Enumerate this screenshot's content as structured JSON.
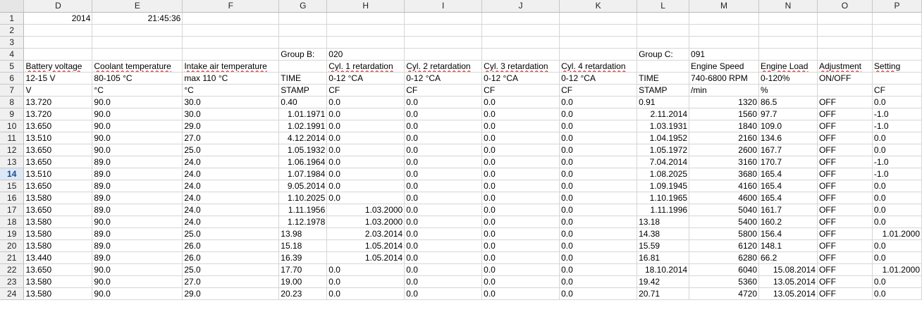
{
  "columns": [
    {
      "id": "D",
      "label": "D"
    },
    {
      "id": "E",
      "label": "E"
    },
    {
      "id": "F",
      "label": "F"
    },
    {
      "id": "G",
      "label": "G"
    },
    {
      "id": "H",
      "label": "H"
    },
    {
      "id": "I",
      "label": "I"
    },
    {
      "id": "J",
      "label": "J"
    },
    {
      "id": "K",
      "label": "K"
    },
    {
      "id": "L",
      "label": "L"
    },
    {
      "id": "M",
      "label": "M"
    },
    {
      "id": "N",
      "label": "N"
    },
    {
      "id": "O",
      "label": "O"
    },
    {
      "id": "P",
      "label": "P"
    }
  ],
  "active_row": "14",
  "rows": [
    {
      "n": "1",
      "cells": [
        [
          "2014",
          "num"
        ],
        [
          "21:45:36",
          "num"
        ],
        [
          "",
          ""
        ],
        [
          "",
          ""
        ],
        [
          "",
          ""
        ],
        [
          "",
          ""
        ],
        [
          "",
          ""
        ],
        [
          "",
          ""
        ],
        [
          "",
          ""
        ],
        [
          "",
          ""
        ],
        [
          "",
          ""
        ],
        [
          "",
          ""
        ],
        [
          "",
          ""
        ]
      ]
    },
    {
      "n": "2",
      "cells": [
        [
          "",
          ""
        ],
        [
          "",
          ""
        ],
        [
          "",
          ""
        ],
        [
          "",
          ""
        ],
        [
          "",
          ""
        ],
        [
          "",
          ""
        ],
        [
          "",
          ""
        ],
        [
          "",
          ""
        ],
        [
          "",
          ""
        ],
        [
          "",
          ""
        ],
        [
          "",
          ""
        ],
        [
          "",
          ""
        ],
        [
          "",
          ""
        ]
      ]
    },
    {
      "n": "3",
      "cells": [
        [
          "",
          ""
        ],
        [
          "",
          ""
        ],
        [
          "",
          ""
        ],
        [
          "",
          ""
        ],
        [
          "",
          ""
        ],
        [
          "",
          ""
        ],
        [
          "",
          ""
        ],
        [
          "",
          ""
        ],
        [
          "",
          ""
        ],
        [
          "",
          ""
        ],
        [
          "",
          ""
        ],
        [
          "",
          ""
        ],
        [
          "",
          ""
        ]
      ]
    },
    {
      "n": "4",
      "cells": [
        [
          "",
          ""
        ],
        [
          "",
          ""
        ],
        [
          "",
          ""
        ],
        [
          "Group B:",
          "txt"
        ],
        [
          "020",
          "txt"
        ],
        [
          "",
          ""
        ],
        [
          "",
          ""
        ],
        [
          "",
          ""
        ],
        [
          "Group C:",
          "txt"
        ],
        [
          "091",
          "txt"
        ],
        [
          "",
          ""
        ],
        [
          "",
          ""
        ],
        [
          "",
          ""
        ]
      ]
    },
    {
      "n": "5",
      "cells": [
        [
          "Battery voltage",
          "sq"
        ],
        [
          "Coolant temperature",
          "sq"
        ],
        [
          "Intake air temperature",
          "sq"
        ],
        [
          "",
          ""
        ],
        [
          "Cyl. 1 retardation",
          "sq"
        ],
        [
          "Cyl. 2 retardation",
          "sq"
        ],
        [
          "Cyl. 3 retardation",
          "sq"
        ],
        [
          "Cyl. 4 retardation",
          "sq"
        ],
        [
          "",
          ""
        ],
        [
          "Engine Speed",
          "txt"
        ],
        [
          "Engine Load",
          "sq"
        ],
        [
          "Adjustment",
          "sq"
        ],
        [
          "Setting",
          "sq"
        ]
      ]
    },
    {
      "n": "6",
      "cells": [
        [
          "12-15 V",
          "txt"
        ],
        [
          "80-105 °C",
          "txt"
        ],
        [
          "max 110 °C",
          "txt"
        ],
        [
          "TIME",
          "txt"
        ],
        [
          "0-12 °CA",
          "txt"
        ],
        [
          "0-12 °CA",
          "txt"
        ],
        [
          "0-12 °CA",
          "txt"
        ],
        [
          "0-12 °CA",
          "txt"
        ],
        [
          "TIME",
          "txt"
        ],
        [
          "740-6800 RPM",
          "txt"
        ],
        [
          "0-120%",
          "txt"
        ],
        [
          "ON/OFF",
          "txt"
        ],
        [
          "",
          ""
        ]
      ]
    },
    {
      "n": "7",
      "cells": [
        [
          " V",
          "txt"
        ],
        [
          "°C",
          "txt"
        ],
        [
          "°C",
          "txt"
        ],
        [
          "STAMP",
          "txt"
        ],
        [
          " CF",
          "txt"
        ],
        [
          " CF",
          "txt"
        ],
        [
          " CF",
          "txt"
        ],
        [
          " CF",
          "txt"
        ],
        [
          "STAMP",
          "txt"
        ],
        [
          " /min",
          "txt"
        ],
        [
          "%",
          "txt"
        ],
        [
          "",
          ""
        ],
        [
          " CF",
          "txt"
        ]
      ]
    },
    {
      "n": "8",
      "cells": [
        [
          "13.720",
          "txt"
        ],
        [
          "90.0",
          "txt"
        ],
        [
          "30.0",
          "txt"
        ],
        [
          "0.40",
          "txt"
        ],
        [
          "0.0",
          "txt"
        ],
        [
          "0.0",
          "txt"
        ],
        [
          "0.0",
          "txt"
        ],
        [
          "0.0",
          "txt"
        ],
        [
          "0.91",
          "txt"
        ],
        [
          "1320",
          "num"
        ],
        [
          "86.5",
          "txt"
        ],
        [
          "OFF",
          "txt"
        ],
        [
          "0.0",
          "txt"
        ]
      ]
    },
    {
      "n": "9",
      "cells": [
        [
          "13.720",
          "txt"
        ],
        [
          "90.0",
          "txt"
        ],
        [
          "30.0",
          "txt"
        ],
        [
          "1.01.1971",
          "num"
        ],
        [
          "0.0",
          "txt"
        ],
        [
          "0.0",
          "txt"
        ],
        [
          "0.0",
          "txt"
        ],
        [
          "0.0",
          "txt"
        ],
        [
          "2.11.2014",
          "num"
        ],
        [
          "1560",
          "num"
        ],
        [
          "97.7",
          "txt"
        ],
        [
          "OFF",
          "txt"
        ],
        [
          "-1.0",
          "txt"
        ]
      ]
    },
    {
      "n": "10",
      "cells": [
        [
          "13.650",
          "txt"
        ],
        [
          "90.0",
          "txt"
        ],
        [
          "29.0",
          "txt"
        ],
        [
          "1.02.1991",
          "num"
        ],
        [
          "0.0",
          "txt"
        ],
        [
          "0.0",
          "txt"
        ],
        [
          "0.0",
          "txt"
        ],
        [
          "0.0",
          "txt"
        ],
        [
          "1.03.1931",
          "num"
        ],
        [
          "1840",
          "num"
        ],
        [
          "109.0",
          "txt"
        ],
        [
          "OFF",
          "txt"
        ],
        [
          "-1.0",
          "txt"
        ]
      ]
    },
    {
      "n": "11",
      "cells": [
        [
          "13.510",
          "txt"
        ],
        [
          "90.0",
          "txt"
        ],
        [
          "27.0",
          "txt"
        ],
        [
          "4.12.2014",
          "num"
        ],
        [
          "0.0",
          "txt"
        ],
        [
          "0.0",
          "txt"
        ],
        [
          "0.0",
          "txt"
        ],
        [
          "0.0",
          "txt"
        ],
        [
          "1.04.1952",
          "num"
        ],
        [
          "2160",
          "num"
        ],
        [
          "134.6",
          "txt"
        ],
        [
          "OFF",
          "txt"
        ],
        [
          "0.0",
          "txt"
        ]
      ]
    },
    {
      "n": "12",
      "cells": [
        [
          "13.650",
          "txt"
        ],
        [
          "90.0",
          "txt"
        ],
        [
          "25.0",
          "txt"
        ],
        [
          "1.05.1932",
          "num"
        ],
        [
          "0.0",
          "txt"
        ],
        [
          "0.0",
          "txt"
        ],
        [
          "0.0",
          "txt"
        ],
        [
          "0.0",
          "txt"
        ],
        [
          "1.05.1972",
          "num"
        ],
        [
          "2600",
          "num"
        ],
        [
          "167.7",
          "txt"
        ],
        [
          "OFF",
          "txt"
        ],
        [
          "0.0",
          "txt"
        ]
      ]
    },
    {
      "n": "13",
      "cells": [
        [
          "13.650",
          "txt"
        ],
        [
          "89.0",
          "txt"
        ],
        [
          "24.0",
          "txt"
        ],
        [
          "1.06.1964",
          "num"
        ],
        [
          "0.0",
          "txt"
        ],
        [
          "0.0",
          "txt"
        ],
        [
          "0.0",
          "txt"
        ],
        [
          "0.0",
          "txt"
        ],
        [
          "7.04.2014",
          "num"
        ],
        [
          "3160",
          "num"
        ],
        [
          "170.7",
          "txt"
        ],
        [
          "OFF",
          "txt"
        ],
        [
          "-1.0",
          "txt"
        ]
      ]
    },
    {
      "n": "14",
      "cells": [
        [
          "13.510",
          "txt"
        ],
        [
          "89.0",
          "txt"
        ],
        [
          "24.0",
          "txt"
        ],
        [
          "1.07.1984",
          "num"
        ],
        [
          "0.0",
          "txt"
        ],
        [
          "0.0",
          "txt"
        ],
        [
          "0.0",
          "txt"
        ],
        [
          "0.0",
          "txt"
        ],
        [
          "1.08.2025",
          "num"
        ],
        [
          "3680",
          "num"
        ],
        [
          "165.4",
          "txt"
        ],
        [
          "OFF",
          "txt"
        ],
        [
          "-1.0",
          "txt"
        ]
      ]
    },
    {
      "n": "15",
      "cells": [
        [
          "13.650",
          "txt"
        ],
        [
          "89.0",
          "txt"
        ],
        [
          "24.0",
          "txt"
        ],
        [
          "9.05.2014",
          "num"
        ],
        [
          "0.0",
          "txt"
        ],
        [
          "0.0",
          "txt"
        ],
        [
          "0.0",
          "txt"
        ],
        [
          "0.0",
          "txt"
        ],
        [
          "1.09.1945",
          "num"
        ],
        [
          "4160",
          "num"
        ],
        [
          "165.4",
          "txt"
        ],
        [
          "OFF",
          "txt"
        ],
        [
          "0.0",
          "txt"
        ]
      ]
    },
    {
      "n": "16",
      "cells": [
        [
          "13.580",
          "txt"
        ],
        [
          "89.0",
          "txt"
        ],
        [
          "24.0",
          "txt"
        ],
        [
          "1.10.2025",
          "num"
        ],
        [
          "0.0",
          "txt"
        ],
        [
          "0.0",
          "txt"
        ],
        [
          "0.0",
          "txt"
        ],
        [
          "0.0",
          "txt"
        ],
        [
          "1.10.1965",
          "num"
        ],
        [
          "4600",
          "num"
        ],
        [
          "165.4",
          "txt"
        ],
        [
          "OFF",
          "txt"
        ],
        [
          "0.0",
          "txt"
        ]
      ]
    },
    {
      "n": "17",
      "cells": [
        [
          "13.650",
          "txt"
        ],
        [
          "89.0",
          "txt"
        ],
        [
          "24.0",
          "txt"
        ],
        [
          "1.11.1956",
          "num"
        ],
        [
          "1.03.2000",
          "num"
        ],
        [
          "0.0",
          "txt"
        ],
        [
          "0.0",
          "txt"
        ],
        [
          "0.0",
          "txt"
        ],
        [
          "1.11.1996",
          "num"
        ],
        [
          "5040",
          "num"
        ],
        [
          "161.7",
          "txt"
        ],
        [
          "OFF",
          "txt"
        ],
        [
          "0.0",
          "txt"
        ]
      ]
    },
    {
      "n": "18",
      "cells": [
        [
          "13.580",
          "txt"
        ],
        [
          "90.0",
          "txt"
        ],
        [
          "24.0",
          "txt"
        ],
        [
          "1.12.1978",
          "num"
        ],
        [
          "1.03.2000",
          "num"
        ],
        [
          "0.0",
          "txt"
        ],
        [
          "0.0",
          "txt"
        ],
        [
          "0.0",
          "txt"
        ],
        [
          "13.18",
          "txt"
        ],
        [
          "5400",
          "num"
        ],
        [
          "160.2",
          "txt"
        ],
        [
          "OFF",
          "txt"
        ],
        [
          "0.0",
          "txt"
        ]
      ]
    },
    {
      "n": "19",
      "cells": [
        [
          "13.580",
          "txt"
        ],
        [
          "89.0",
          "txt"
        ],
        [
          "25.0",
          "txt"
        ],
        [
          "13.98",
          "txt"
        ],
        [
          "2.03.2014",
          "num"
        ],
        [
          "0.0",
          "txt"
        ],
        [
          "0.0",
          "txt"
        ],
        [
          "0.0",
          "txt"
        ],
        [
          "14.38",
          "txt"
        ],
        [
          "5800",
          "num"
        ],
        [
          "156.4",
          "txt"
        ],
        [
          "OFF",
          "txt"
        ],
        [
          "1.01.2000",
          "num"
        ]
      ]
    },
    {
      "n": "20",
      "cells": [
        [
          "13.580",
          "txt"
        ],
        [
          "89.0",
          "txt"
        ],
        [
          "26.0",
          "txt"
        ],
        [
          "15.18",
          "txt"
        ],
        [
          "1.05.2014",
          "num"
        ],
        [
          "0.0",
          "txt"
        ],
        [
          "0.0",
          "txt"
        ],
        [
          "0.0",
          "txt"
        ],
        [
          "15.59",
          "txt"
        ],
        [
          "6120",
          "num"
        ],
        [
          "148.1",
          "txt"
        ],
        [
          "OFF",
          "txt"
        ],
        [
          "0.0",
          "txt"
        ]
      ]
    },
    {
      "n": "21",
      "cells": [
        [
          "13.440",
          "txt"
        ],
        [
          "89.0",
          "txt"
        ],
        [
          "26.0",
          "txt"
        ],
        [
          "16.39",
          "txt"
        ],
        [
          "1.05.2014",
          "num"
        ],
        [
          "0.0",
          "txt"
        ],
        [
          "0.0",
          "txt"
        ],
        [
          "0.0",
          "txt"
        ],
        [
          "16.81",
          "txt"
        ],
        [
          "6280",
          "num"
        ],
        [
          "66.2",
          "txt"
        ],
        [
          "OFF",
          "txt"
        ],
        [
          "0.0",
          "txt"
        ]
      ]
    },
    {
      "n": "22",
      "cells": [
        [
          "13.650",
          "txt"
        ],
        [
          "90.0",
          "txt"
        ],
        [
          "25.0",
          "txt"
        ],
        [
          "17.70",
          "txt"
        ],
        [
          "0.0",
          "txt"
        ],
        [
          "0.0",
          "txt"
        ],
        [
          "0.0",
          "txt"
        ],
        [
          "0.0",
          "txt"
        ],
        [
          "18.10.2014",
          "num"
        ],
        [
          "6040",
          "num"
        ],
        [
          "15.08.2014",
          "num"
        ],
        [
          "OFF",
          "txt"
        ],
        [
          "1.01.2000",
          "num"
        ]
      ]
    },
    {
      "n": "23",
      "cells": [
        [
          "13.580",
          "txt"
        ],
        [
          "90.0",
          "txt"
        ],
        [
          "27.0",
          "txt"
        ],
        [
          "19.00",
          "txt"
        ],
        [
          "0.0",
          "txt"
        ],
        [
          "0.0",
          "txt"
        ],
        [
          "0.0",
          "txt"
        ],
        [
          "0.0",
          "txt"
        ],
        [
          "19.42",
          "txt"
        ],
        [
          "5360",
          "num"
        ],
        [
          "13.05.2014",
          "num"
        ],
        [
          "OFF",
          "txt"
        ],
        [
          "0.0",
          "txt"
        ]
      ]
    },
    {
      "n": "24",
      "cells": [
        [
          "13.580",
          "txt"
        ],
        [
          "90.0",
          "txt"
        ],
        [
          "29.0",
          "txt"
        ],
        [
          "20.23",
          "txt"
        ],
        [
          "0.0",
          "txt"
        ],
        [
          "0.0",
          "txt"
        ],
        [
          "0.0",
          "txt"
        ],
        [
          "0.0",
          "txt"
        ],
        [
          "20.71",
          "txt"
        ],
        [
          "4720",
          "num"
        ],
        [
          "13.05.2014",
          "num"
        ],
        [
          "OFF",
          "txt"
        ],
        [
          "0.0",
          "txt"
        ]
      ]
    }
  ]
}
